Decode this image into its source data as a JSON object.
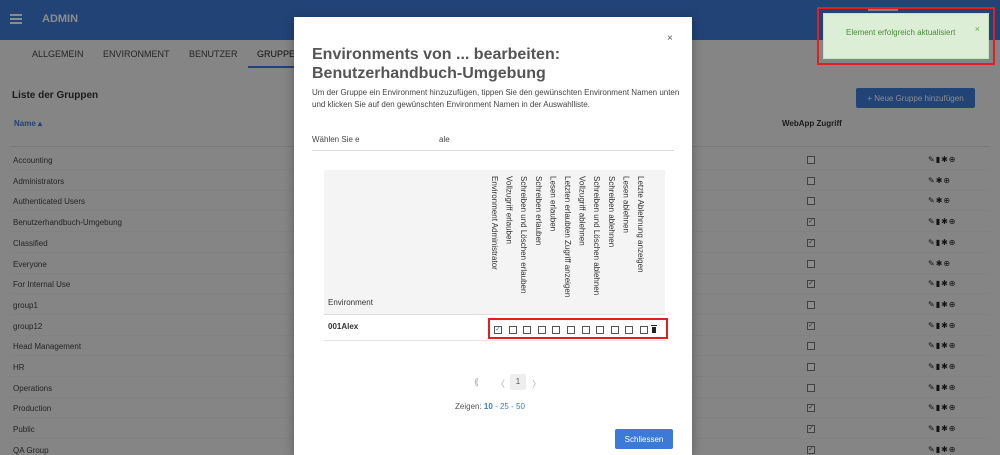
{
  "app": {
    "title": "ADMIN"
  },
  "tabs": [
    {
      "label": "ALLGEMEIN"
    },
    {
      "label": "ENVIRONMENT"
    },
    {
      "label": "BENUTZER"
    },
    {
      "label": "GRUPPEN"
    }
  ],
  "list": {
    "title": "Liste der Gruppen",
    "add_button": "+ Neue Gruppe hinzufügen",
    "col_name": "Name ▴",
    "col_webapp": "WebApp Zugriff",
    "rows": [
      {
        "name": "Accounting",
        "webapp": "",
        "actions": "✎▮✱⊕"
      },
      {
        "name": "Administrators",
        "webapp": "",
        "actions": "✎✱⊕"
      },
      {
        "name": "Authenticated Users",
        "webapp": "",
        "actions": "✎✱⊕"
      },
      {
        "name": "Benutzerhandbuch-Umgebung",
        "webapp": "✓",
        "actions": "✎▮✱⊕"
      },
      {
        "name": "Classified",
        "webapp": "✓",
        "actions": "✎▮✱⊕"
      },
      {
        "name": "Everyone",
        "webapp": "",
        "actions": "✎✱⊕"
      },
      {
        "name": "For Internal Use",
        "webapp": "✓",
        "actions": "✎▮✱⊕"
      },
      {
        "name": "group1",
        "webapp": "",
        "actions": "✎▮✱⊕"
      },
      {
        "name": "group12",
        "webapp": "✓",
        "actions": "✎▮✱⊕"
      },
      {
        "name": "Head Management",
        "webapp": "",
        "actions": "✎▮✱⊕"
      },
      {
        "name": "HR",
        "webapp": "",
        "actions": "✎▮✱⊕"
      },
      {
        "name": "Operations",
        "webapp": "",
        "actions": "✎▮✱⊕"
      },
      {
        "name": "Production",
        "webapp": "✓",
        "actions": "✎▮✱⊕"
      },
      {
        "name": "Public",
        "webapp": "✓",
        "actions": "✎▮✱⊕"
      },
      {
        "name": "QA Group",
        "webapp": "✓",
        "actions": "✎▮✱⊕"
      }
    ]
  },
  "toast": {
    "message": "Element erfolgreich aktualisiert",
    "close": "×"
  },
  "modal": {
    "close": "×",
    "title": "Environments von ... bearbeiten: Benutzerhandbuch-Umgebung",
    "description": "Um der Gruppe ein Environment hinzuzufügen, tippen Sie den gewünschten Environment Namen unten und klicken Sie auf den gewünschten Environment Namen in der Auswahlliste.",
    "select_label": "Wählen Sie e",
    "select_value": "ale",
    "env_column": "Environment",
    "permission_columns": [
      "Environment Administrator",
      "Vollzugriff erlauben",
      "Schreiben und Löschen erlauben",
      "Schreiben erlauben",
      "Lesen erlauben",
      "Letzten erlaubten Zugriff anzeigen",
      "Vollzugriff ablehnen",
      "Schreiben und Löschen ablehnen",
      "Schreiben ablehnen",
      "Lesen ablehnen",
      "Letzte Ablehnung anzeigen"
    ],
    "environments": [
      {
        "name": "001Alex",
        "checks": [
          "✓",
          "",
          "",
          "",
          "",
          "",
          "",
          "",
          "",
          "",
          ""
        ]
      }
    ],
    "pager": {
      "first": "⟪",
      "prev": "〈",
      "page": "1",
      "next": "〉"
    },
    "page_size_label": "Zeigen:",
    "page_sizes": [
      "10",
      "25",
      "50"
    ],
    "close_button": "Schliessen"
  },
  "colors": {
    "primary": "#3d7ad8",
    "highlight": "#e02020",
    "toast_bg": "#dcefd6"
  }
}
